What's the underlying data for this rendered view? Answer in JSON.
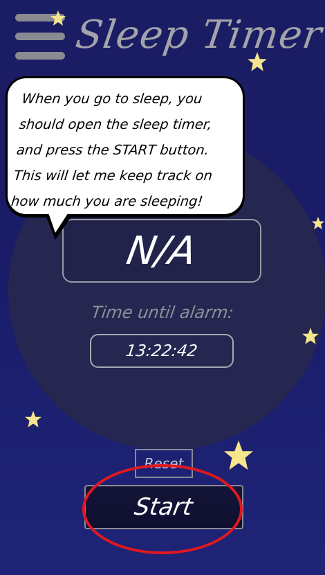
{
  "header": {
    "title": "Sleep Timer",
    "menu_icon": "hamburger-menu-icon"
  },
  "tutorial": {
    "message": "When you go to sleep, you should open the sleep timer, and press the START button. This will let me keep track on how much you are sleeping!"
  },
  "timer": {
    "status_value": "N/A",
    "alarm_label": "Time until alarm:",
    "time_until_alarm": "13:22:42"
  },
  "controls": {
    "reset_label": "Reset",
    "start_label": "Start"
  },
  "colors": {
    "background": "#1b1d63",
    "circle": "#252751",
    "star": "#f6e58d",
    "highlight": "#e0181f"
  }
}
